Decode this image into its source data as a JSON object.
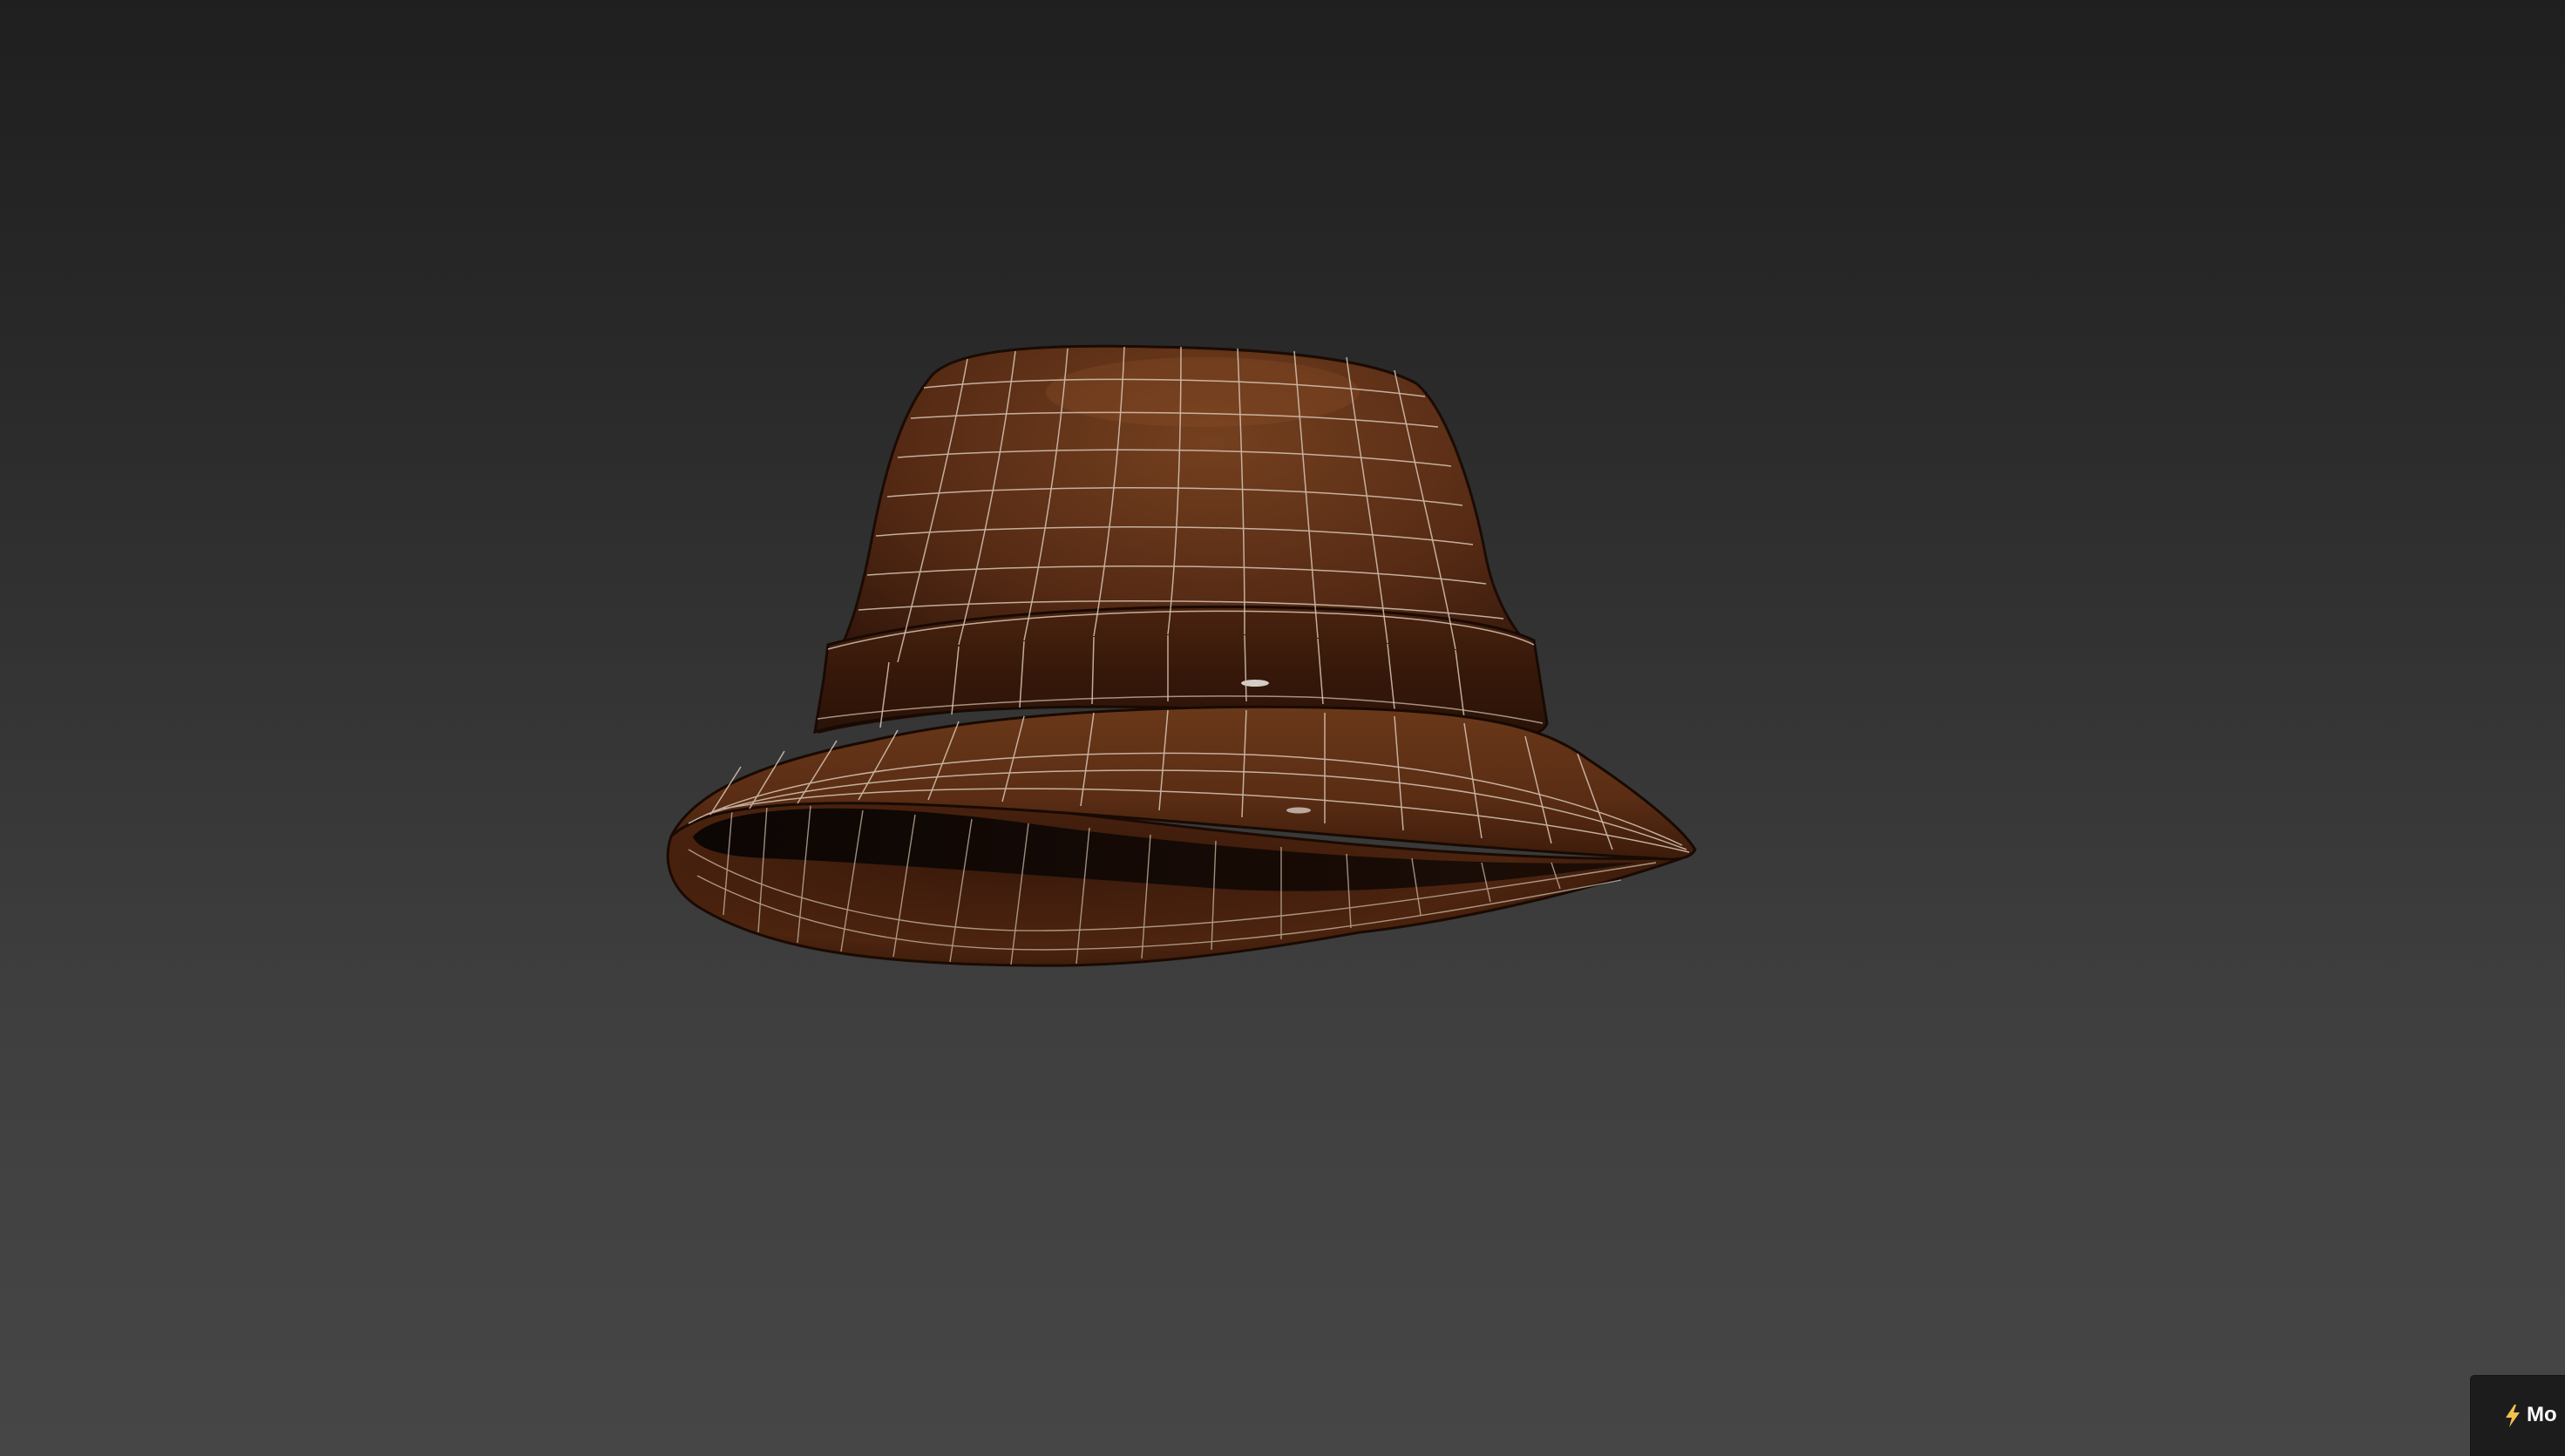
{
  "viewport": {
    "background_top": "#1f1f1f",
    "background_bottom": "#464646"
  },
  "model": {
    "name": "bucket-hat",
    "base_color": "#5a2e17",
    "wire_color": "#d8c7b6",
    "display_mode": "shaded-with-wireframe"
  },
  "corner_badge": {
    "icon": "lightning-bolt-icon",
    "label": "Mo"
  }
}
